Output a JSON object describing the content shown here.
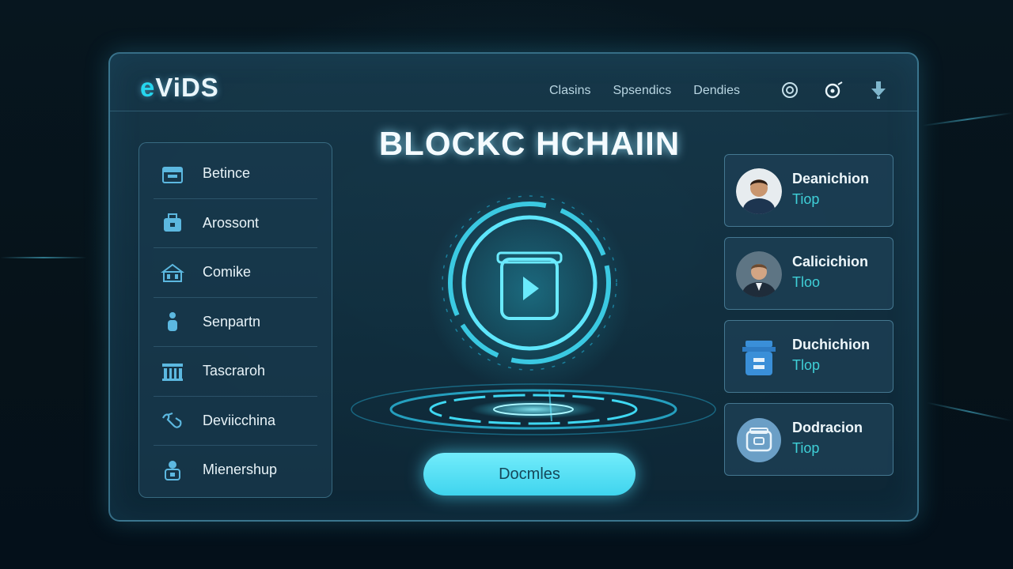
{
  "app": {
    "logo_prefix": "e",
    "logo_rest": "ViDS"
  },
  "topnav": {
    "items": [
      "Clasins",
      "Spsendics",
      "Dendies"
    ]
  },
  "top_icons": [
    "target-icon",
    "record-icon",
    "download-icon"
  ],
  "sidebar": {
    "items": [
      {
        "label": "Betince",
        "icon": "calendar-icon"
      },
      {
        "label": "Arossont",
        "icon": "bag-icon"
      },
      {
        "label": "Comike",
        "icon": "building-icon"
      },
      {
        "label": "Senpartn",
        "icon": "person-icon"
      },
      {
        "label": "Tascraroh",
        "icon": "bank-icon"
      },
      {
        "label": "Deviicchina",
        "icon": "handshake-icon"
      },
      {
        "label": "Mienershup",
        "icon": "member-icon"
      }
    ]
  },
  "main": {
    "title": "BLOCKC HCHAIIN",
    "cta_label": "Docmles",
    "hero_icon": "video-box-icon"
  },
  "cards": [
    {
      "title": "Deanichion",
      "subtitle": "Tiop",
      "avatar": "man-avatar"
    },
    {
      "title": "Calicichion",
      "subtitle": "Tloo",
      "avatar": "suit-man-avatar"
    },
    {
      "title": "Duchichion",
      "subtitle": "Tlop",
      "avatar": "blue-box-icon"
    },
    {
      "title": "Dodracion",
      "subtitle": "Tiop",
      "avatar": "package-icon"
    }
  ],
  "colors": {
    "accent": "#26d5ee",
    "cta": "#5fe3f6",
    "subtitle": "#3fd0d8",
    "panel_border": "#5aaac8"
  }
}
